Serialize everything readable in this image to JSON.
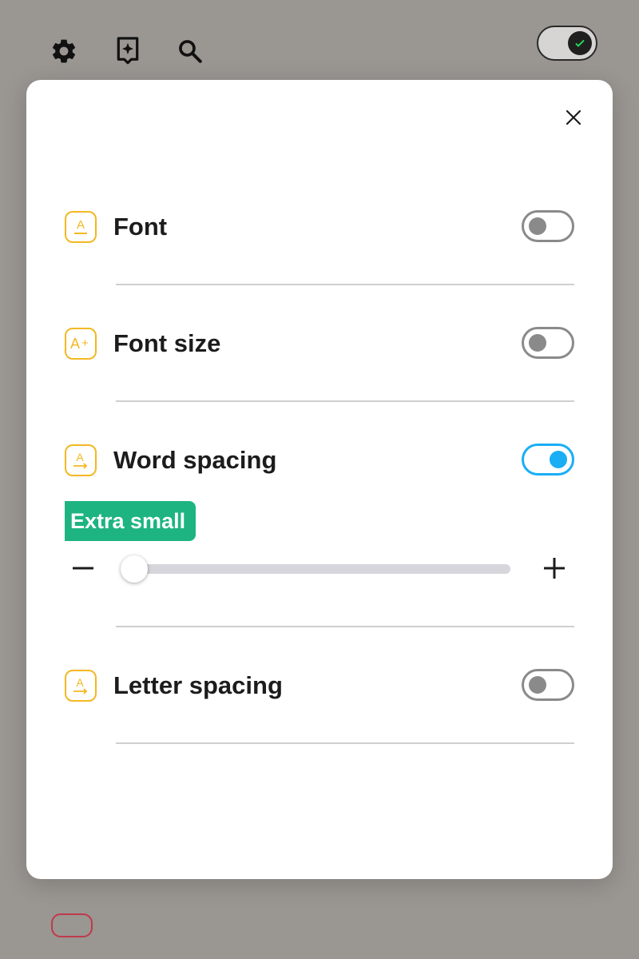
{
  "topbar": {
    "icons": [
      "gear-icon",
      "sparkle-bookmark-icon",
      "search-icon"
    ],
    "master_toggle": {
      "state": "on",
      "icon": "check-icon"
    }
  },
  "dialog": {
    "close_icon": "close-icon",
    "settings": [
      {
        "label": "Font",
        "icon": "font-icon",
        "enabled": false
      },
      {
        "label": "Font size",
        "icon": "font-size-icon",
        "enabled": false
      },
      {
        "label": "Word spacing",
        "icon": "word-spacing-icon",
        "enabled": true,
        "level_label": "Extra small",
        "slider": {
          "value_fraction": 0.0,
          "decrease_icon": "minus-icon",
          "increase_icon": "plus-icon"
        }
      },
      {
        "label": "Letter spacing",
        "icon": "letter-spacing-icon",
        "enabled": false
      }
    ]
  },
  "colors": {
    "accent_icon": "#f3b822",
    "toggle_on": "#1aaef5",
    "toggle_off": "#8a8a8a",
    "badge": "#1db482",
    "backdrop": "#9a9692"
  }
}
